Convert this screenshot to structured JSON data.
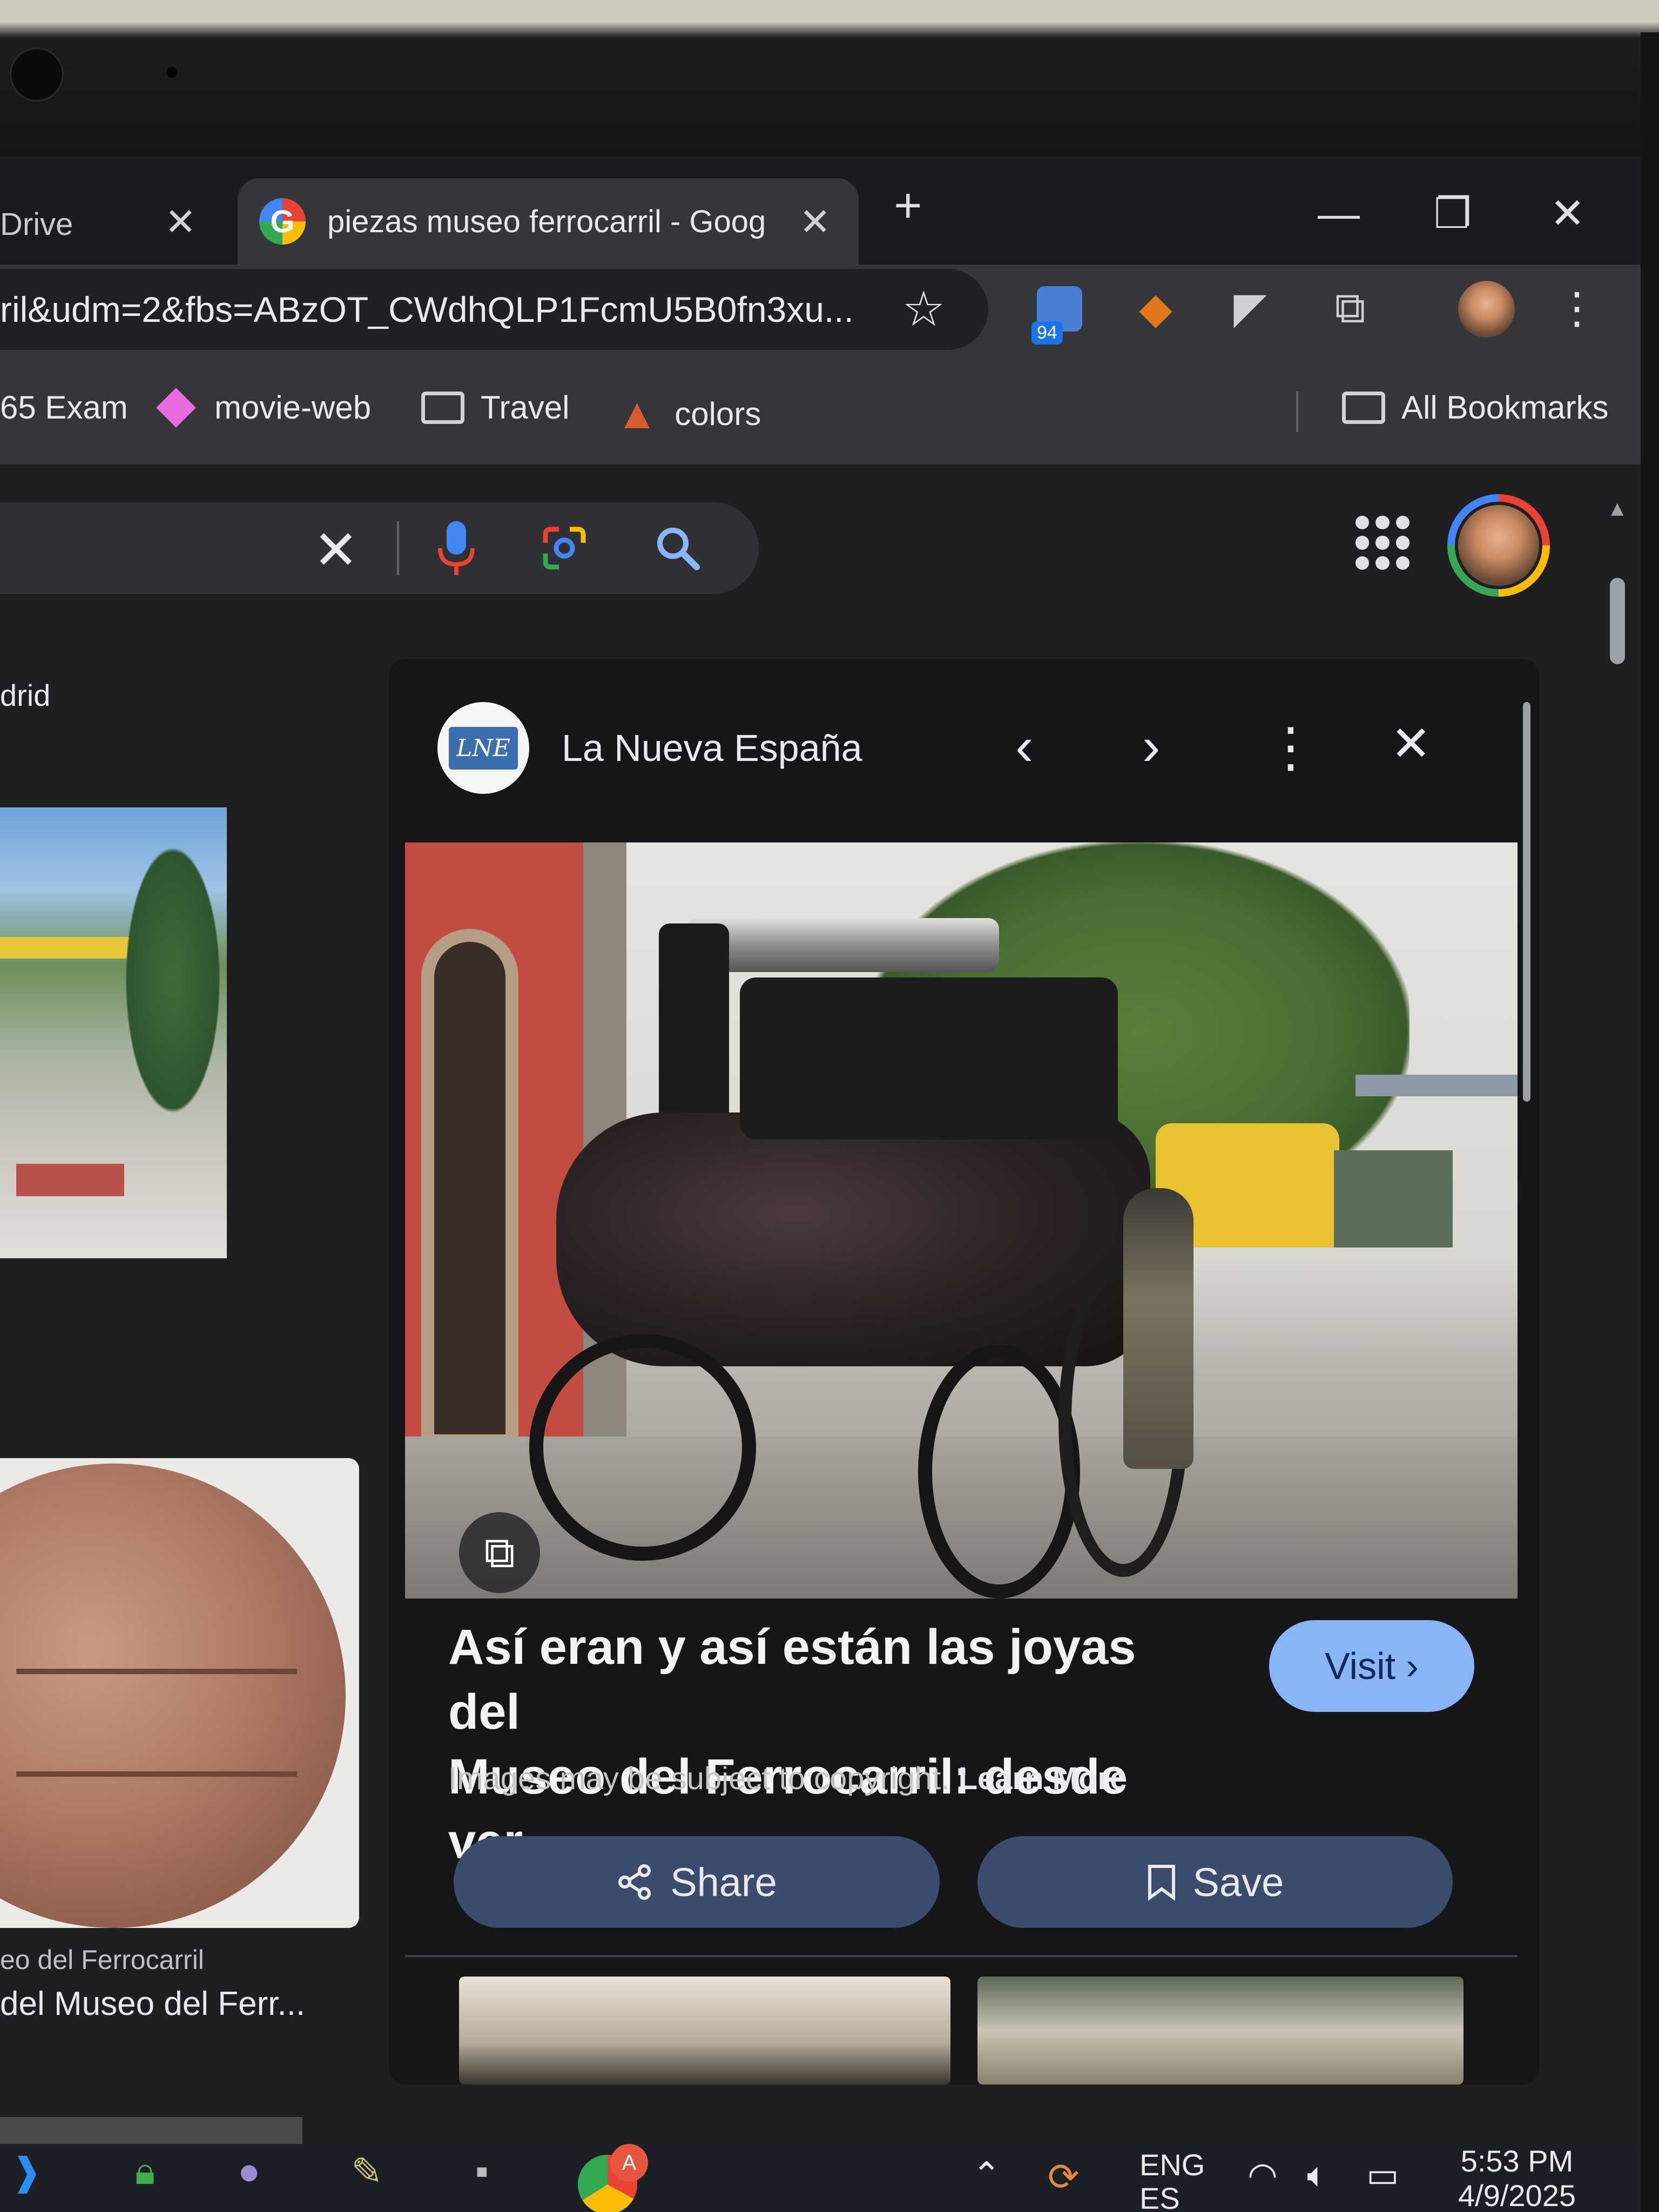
{
  "tabs": [
    {
      "title": "Drive",
      "active": false
    },
    {
      "title": "piezas museo ferrocarril - Goog",
      "active": true
    }
  ],
  "new_tab_symbol": "+",
  "window_controls": {
    "minimize": "—",
    "restore": "❐",
    "close": "✕"
  },
  "address_bar": {
    "url": "ril&udm=2&fbs=ABzOT_CWdhQLP1FcmU5B0fn3xu..."
  },
  "extensions": {
    "badge": "94"
  },
  "bookmarks": [
    "65 Exam",
    "movie-web",
    "Travel",
    "colors"
  ],
  "all_bookmarks_label": "All Bookmarks",
  "left_column": {
    "heading": "drid",
    "result_source": "eo del Ferrocarril",
    "result_title": "del Museo del Ferr..."
  },
  "panel": {
    "source": "La Nueva España",
    "logo_text": "LNE",
    "title_line1": "Así eran y así están las joyas del",
    "title_line2": "Museo del Ferrocarril: desde ver...",
    "visit_label": "Visit ›",
    "copyright_text": "Images may be subject to copyright.",
    "learn_more": "Learn More",
    "share_label": "Share",
    "save_label": "Save"
  },
  "taskbar": {
    "language_line1": "ENG",
    "language_line2": "ES",
    "time": "5:53 PM",
    "date": "4/9/2025",
    "notification_badge": "A"
  },
  "colors": {
    "accent": "#8ab4f8",
    "pill": "#3c4c6c",
    "background": "#1f1f21"
  }
}
